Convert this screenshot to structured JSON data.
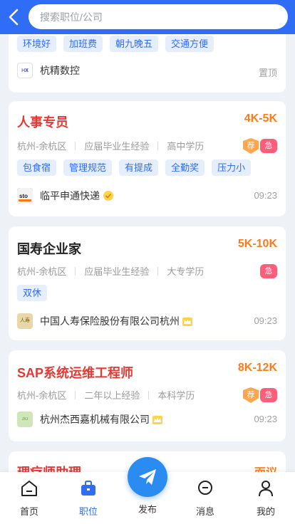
{
  "header": {
    "back_icon": "chevron-left-icon",
    "search_placeholder": "搜索职位/公司",
    "bg_color": "#2f6df6"
  },
  "jobs": [
    {
      "tags": [
        "环境好",
        "加班费",
        "朝九晚五",
        "交通方便"
      ],
      "company": "杭精数控",
      "status": "置顶"
    },
    {
      "title": "人事专员",
      "salary": "4K-5K",
      "location": "杭州-余杭区",
      "experience": "应届毕业生经验",
      "education": "高中学历",
      "badge_recommend": "荐",
      "badge_urgent": "急",
      "tags": [
        "包食宿",
        "管理规范",
        "有提成",
        "全勤奖",
        "压力小"
      ],
      "company": "临平申通快递",
      "time": "09:23"
    },
    {
      "title": "国寿企业家",
      "salary": "5K-10K",
      "location": "杭州-余杭区",
      "experience": "应届毕业生经验",
      "education": "大专学历",
      "badge_urgent": "急",
      "tags": [
        "双休"
      ],
      "company": "中国人寿保险股份有限公司杭州",
      "time": "09:23"
    },
    {
      "title": "SAP系统运维工程师",
      "salary": "8K-12K",
      "location": "杭州-余杭区",
      "experience": "二年以上经验",
      "education": "本科学历",
      "badge_recommend": "荐",
      "badge_urgent": "急",
      "company": "杭州杰西嘉机械有限公司",
      "time": "09:23"
    },
    {
      "title": "理疗师助理",
      "salary": "面议"
    }
  ],
  "nav": {
    "home": "首页",
    "jobs": "职位",
    "publish": "发布",
    "messages": "消息",
    "mine": "我的"
  },
  "accent_color": "#2f6df6",
  "salary_color": "#ff7a1a"
}
